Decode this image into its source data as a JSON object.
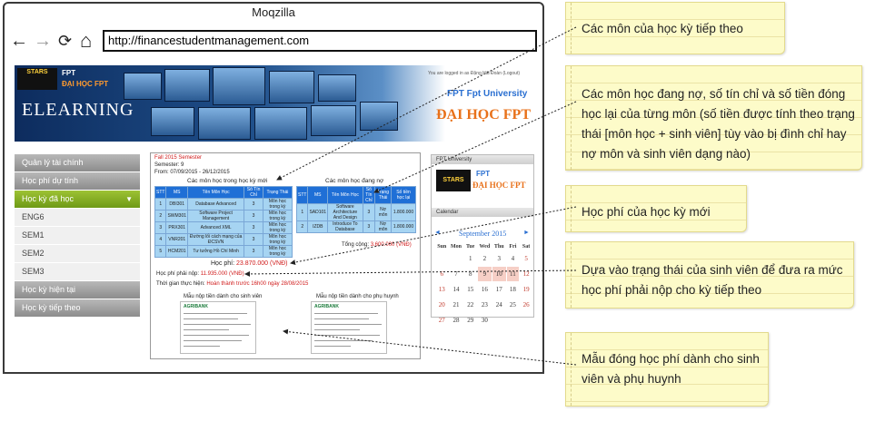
{
  "browser": {
    "title": "Moqzilla",
    "url": "http://financestudentmanagement.com",
    "nav": {
      "back_icon": "←",
      "forward_icon": "→",
      "reload_icon": "⟳",
      "home_icon": "⌂"
    }
  },
  "header": {
    "stars_logo": "STARS",
    "fpt_text": "FPT",
    "university_small": "ĐẠI HỌC FPT",
    "elearning": "ELEARNING",
    "logged_in": "You are logged in as Đặng Hải Đoàn (Logout)",
    "fpt_university": "FPT  Fpt University",
    "university_big": "ĐẠI HỌC FPT"
  },
  "menu": [
    {
      "label": "Quản lý tài chính",
      "style": "gray"
    },
    {
      "label": "Học phí dự tính",
      "style": "gray"
    },
    {
      "label": "Học kỳ đã học",
      "style": "active"
    },
    {
      "label": "ENG6",
      "style": "sub"
    },
    {
      "label": "SEM1",
      "style": "sub"
    },
    {
      "label": "SEM2",
      "style": "sub"
    },
    {
      "label": "SEM3",
      "style": "sub"
    },
    {
      "label": "Học kỳ hiện tại",
      "style": "gray"
    },
    {
      "label": "Học kỳ tiếp theo",
      "style": "gray"
    }
  ],
  "content": {
    "semester_title": "Fall 2015 Semester",
    "semester_line": "Semester: 9",
    "from_line": "From: 07/09/2015 - 26/12/2015",
    "new_subjects_title": "Các môn học trong học kỳ mới",
    "new_headers": [
      "STT",
      "MS",
      "Tên Môn Học",
      "Số Tín Chỉ",
      "Trạng Thái"
    ],
    "new_rows": [
      [
        "1",
        "DBI301",
        "Database Advanced",
        "3",
        "Môn học trong kỳ"
      ],
      [
        "2",
        "SWM301",
        "Software Project Management",
        "3",
        "Môn học trong kỳ"
      ],
      [
        "3",
        "PRX301",
        "Advanced XML",
        "3",
        "Môn học trong kỳ"
      ],
      [
        "4",
        "VNR201",
        "Đường lối cách mạng của ĐCSVN",
        "3",
        "Môn học trong kỳ"
      ],
      [
        "5",
        "HCM201",
        "Tư tưởng Hồ Chí Minh",
        "3",
        "Môn học trong kỳ"
      ]
    ],
    "debt_title": "Các môn học đang nợ",
    "debt_headers": [
      "STT",
      "MS",
      "Tên Môn Học",
      "Số Tín Chỉ",
      "Trạng Thái",
      "Số tiền học lại"
    ],
    "debt_rows": [
      [
        "1",
        "SAD101",
        "Software Architecture And Design",
        "3",
        "Nợ môn",
        "1.800.000"
      ],
      [
        "2",
        "IZDB",
        "Introduce To Database",
        "3",
        "Nợ môn",
        "1.800.000"
      ]
    ],
    "total_label": "Tổng cộng:",
    "total_value": "3.600.000 (VNĐ)",
    "tuition_label": "Học phí:",
    "tuition_value": "23.870.000 (VNĐ)",
    "must_pay_label": "Học phí phải nộp:",
    "must_pay_value": "11.935.000 (VNĐ)",
    "deadline_label": "Thời gian thực hiện:",
    "deadline_value": "Hoàn thành trước 16h00 ngày 28/08/2015",
    "form_student_title": "Mẫu nộp tiền dành cho sinh viên",
    "form_parent_title": "Mẫu nộp tiền dành cho phụ huynh",
    "agribank": "AGRIBANK"
  },
  "sidebar": {
    "fpt_university_header": "FPT University",
    "stars_logo": "STARS",
    "fpt_text": "FPT",
    "university": "ĐẠI HỌC FPT",
    "calendar_header": "Calendar",
    "month": "September 2015",
    "prev_icon": "◄",
    "next_icon": "►",
    "weekdays": [
      "Sun",
      "Mon",
      "Tue",
      "Wed",
      "Thu",
      "Fri",
      "Sat"
    ],
    "weeks": [
      [
        "",
        "",
        "1",
        "2",
        "3",
        "4",
        "5"
      ],
      [
        "6",
        "7",
        "8",
        "9",
        "10",
        "11",
        "12"
      ],
      [
        "13",
        "14",
        "15",
        "16",
        "17",
        "18",
        "19"
      ],
      [
        "20",
        "21",
        "22",
        "23",
        "24",
        "25",
        "26"
      ],
      [
        "27",
        "28",
        "29",
        "30",
        "",
        "",
        ""
      ]
    ],
    "highlighted_days": [
      "9",
      "10",
      "11"
    ]
  },
  "notes": [
    "Các môn của học kỳ tiếp theo",
    "Các môn học đang nợ, số tín chỉ và số tiền đóng học lại của từng môn (số tiền được tính theo trạng thái [môn học + sinh viên] tùy vào bị đình chỉ hay nợ môn và sinh viên dạng nào)",
    "Học phí của học kỳ mới",
    "Dựa vào trạng thái của sinh viên để đưa ra mức học phí phải nộp cho kỳ tiếp theo",
    "Mẫu đóng học phí dành cho sinh viên và phụ huynh"
  ],
  "colors": {
    "accent_green": "#7aa51f",
    "table_header": "#1f6fd6",
    "table_cell": "#a6d4f2",
    "note_bg": "#fdfbc9",
    "red": "#d01a1a"
  }
}
